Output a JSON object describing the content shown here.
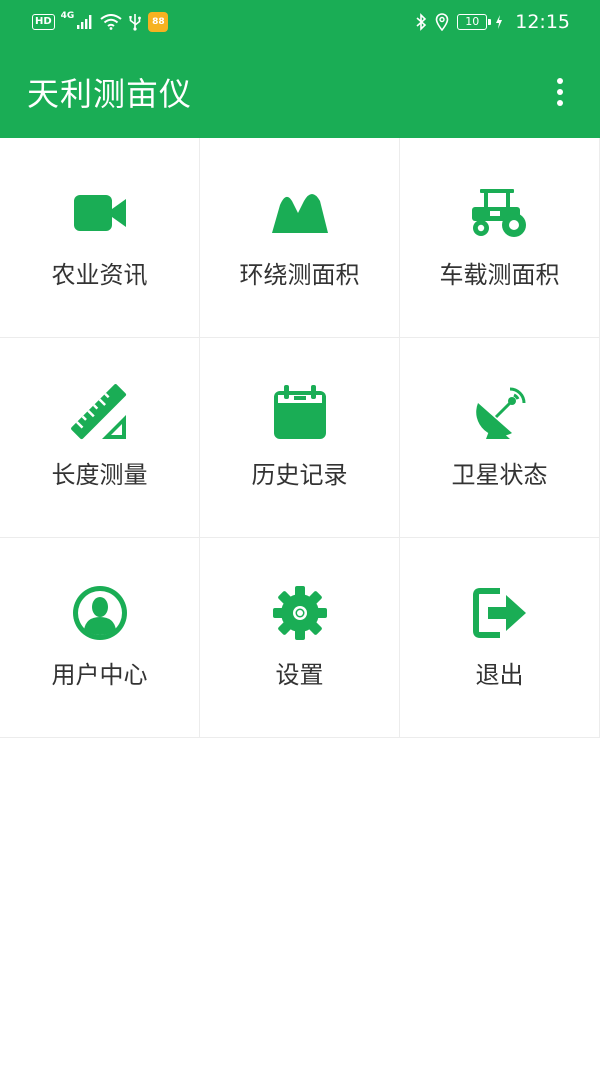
{
  "status_bar": {
    "hd": "HD",
    "network": "4G",
    "app_badge": "88",
    "battery": "10",
    "time": "12:15"
  },
  "app_bar": {
    "title": "天利测亩仪"
  },
  "menu": [
    {
      "label": "农业资讯",
      "icon": "video-camera-icon"
    },
    {
      "label": "环绕测面积",
      "icon": "mountain-icon"
    },
    {
      "label": "车载测面积",
      "icon": "tractor-icon"
    },
    {
      "label": "长度测量",
      "icon": "ruler-icon"
    },
    {
      "label": "历史记录",
      "icon": "calendar-icon"
    },
    {
      "label": "卫星状态",
      "icon": "satellite-dish-icon"
    },
    {
      "label": "用户中心",
      "icon": "user-circle-icon"
    },
    {
      "label": "设置",
      "icon": "gear-icon"
    },
    {
      "label": "退出",
      "icon": "exit-icon"
    }
  ],
  "colors": {
    "primary": "#1aad55",
    "icon": "#1aad55",
    "text": "#333333",
    "divider": "#ececec"
  }
}
